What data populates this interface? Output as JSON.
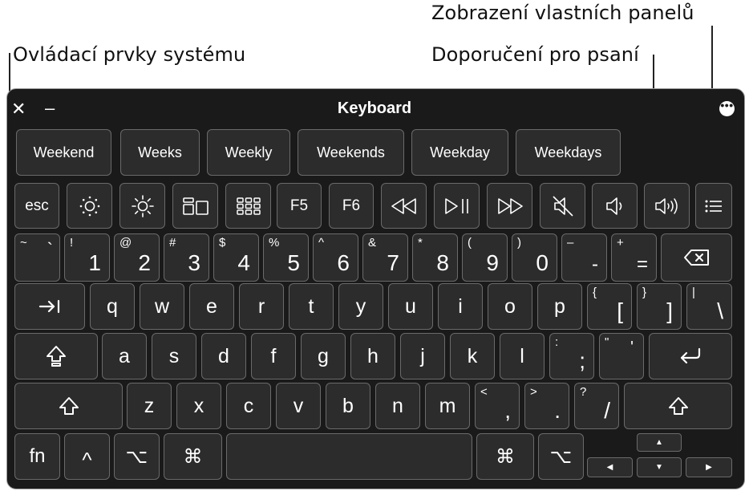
{
  "callouts": {
    "custom_panels": "Zobrazení vlastních panelů",
    "system_controls": "Ovládací prvky systému",
    "typing_suggestions": "Doporučení pro psaní"
  },
  "window": {
    "title": "Keyboard",
    "close_glyph": "✕",
    "minimize_glyph": "–",
    "more_glyph": "•••"
  },
  "suggestions": [
    "Weekend",
    "Weeks",
    "Weekly",
    "Weekends",
    "Weekday",
    "Weekdays"
  ],
  "function_row": {
    "esc": "esc",
    "f5": "F5",
    "f6": "F6",
    "icons": [
      "brightness-down-icon",
      "brightness-up-icon",
      "mission-control-icon",
      "launchpad-icon",
      "rewind-icon",
      "play-pause-icon",
      "fast-forward-icon",
      "mute-icon",
      "volume-down-icon",
      "volume-up-icon",
      "panels-list-icon"
    ]
  },
  "number_row": [
    {
      "sec": "~",
      "pri": "`"
    },
    {
      "sec": "!",
      "pri": "1"
    },
    {
      "sec": "@",
      "pri": "2"
    },
    {
      "sec": "#",
      "pri": "3"
    },
    {
      "sec": "$",
      "pri": "4"
    },
    {
      "sec": "%",
      "pri": "5"
    },
    {
      "sec": "^",
      "pri": "6"
    },
    {
      "sec": "&",
      "pri": "7"
    },
    {
      "sec": "*",
      "pri": "8"
    },
    {
      "sec": "(",
      "pri": "9"
    },
    {
      "sec": ")",
      "pri": "0"
    },
    {
      "sec": "–",
      "pri": "-"
    },
    {
      "sec": "+",
      "pri": "="
    }
  ],
  "qwerty_row": [
    "q",
    "w",
    "e",
    "r",
    "t",
    "y",
    "u",
    "i",
    "o",
    "p"
  ],
  "qwerty_extra": [
    {
      "sec": "{",
      "pri": "["
    },
    {
      "sec": "}",
      "pri": "]"
    },
    {
      "sec": "|",
      "pri": "\\"
    }
  ],
  "home_row": [
    "a",
    "s",
    "d",
    "f",
    "g",
    "h",
    "j",
    "k",
    "l"
  ],
  "home_extra": [
    {
      "sec": ":",
      "pri": ";"
    },
    {
      "sec": "\"",
      "pri": "'"
    }
  ],
  "bottom_row": [
    "z",
    "x",
    "c",
    "v",
    "b",
    "n",
    "m"
  ],
  "bottom_extra": [
    {
      "sec": "<",
      "pri": ","
    },
    {
      "sec": ">",
      "pri": "."
    },
    {
      "sec": "?",
      "pri": "/"
    }
  ],
  "modifiers": {
    "fn": "fn",
    "control": "^",
    "option": "⌥",
    "command": "⌘",
    "arrow_up": "▲",
    "arrow_down": "▼",
    "arrow_left": "◀",
    "arrow_right": "▶"
  },
  "colors": {
    "panel": "#1a1a1a",
    "key": "#2c2c2c",
    "key_border": "#6a6a6a",
    "text": "#ffffff"
  }
}
